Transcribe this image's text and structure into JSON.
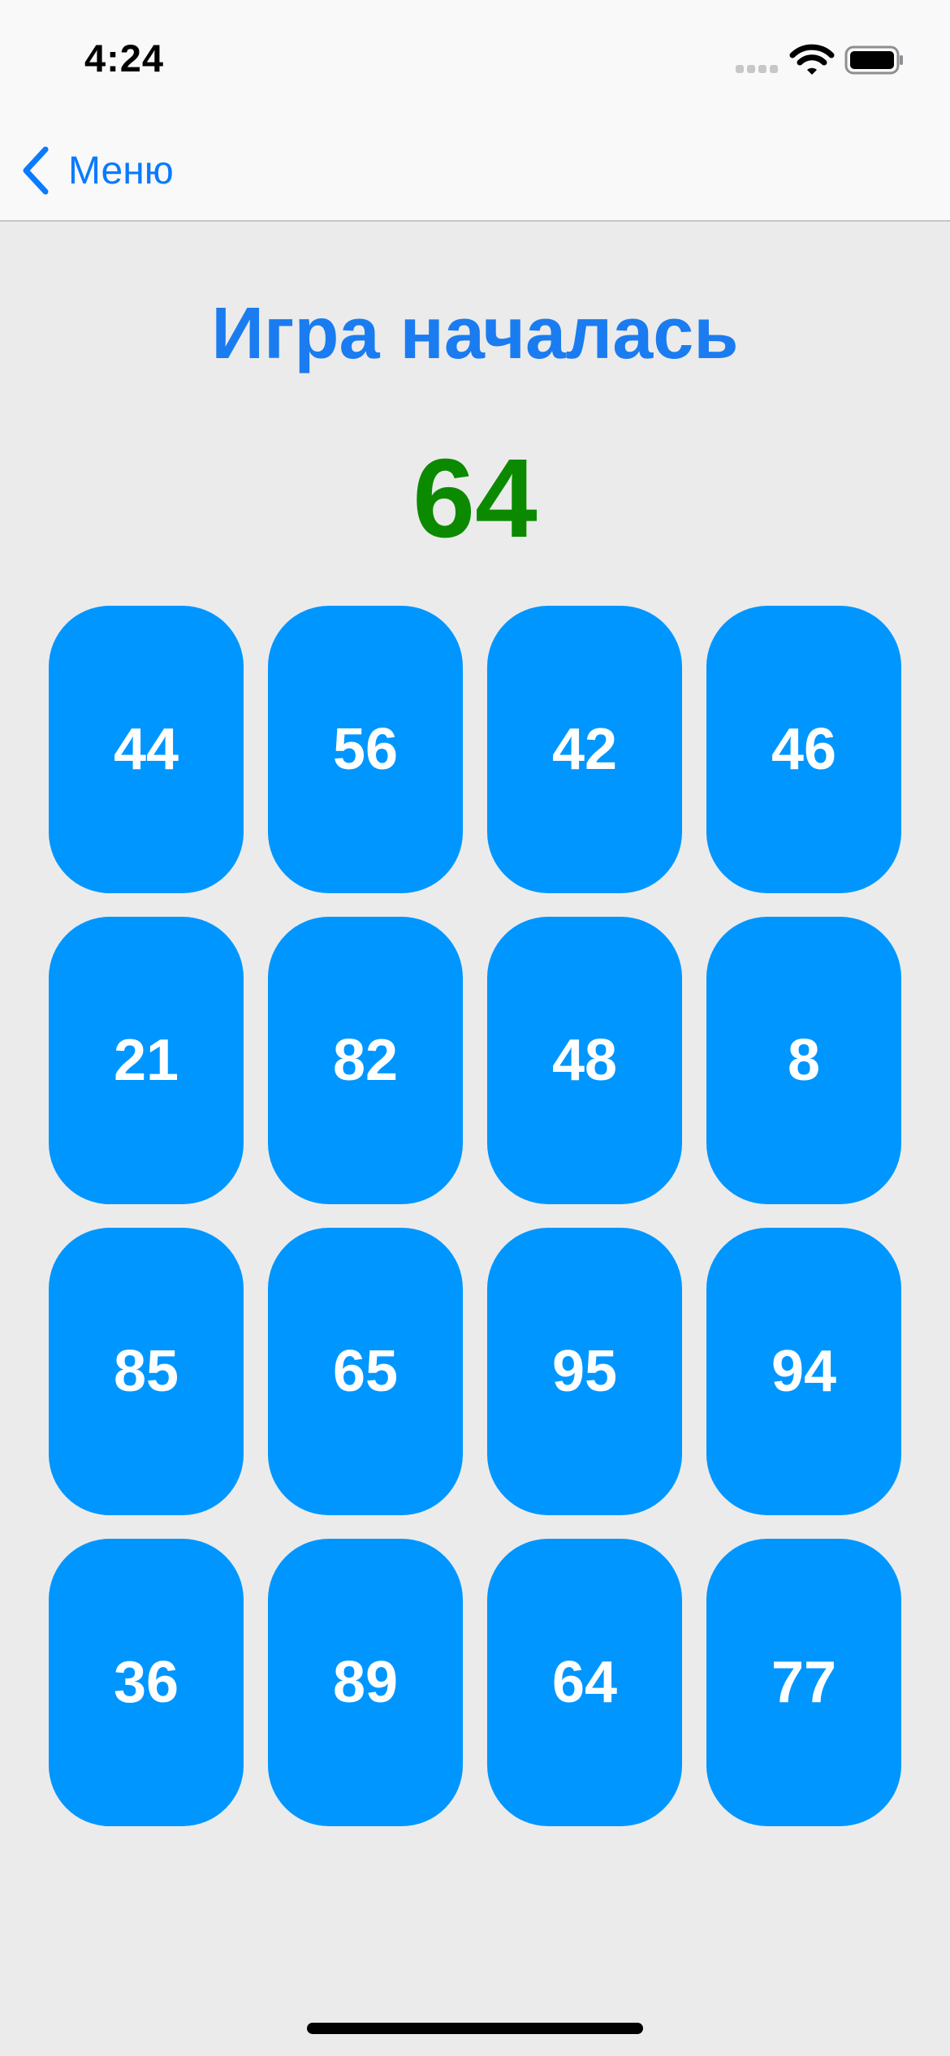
{
  "status_bar": {
    "time": "4:24"
  },
  "nav": {
    "back_label": "Меню"
  },
  "game": {
    "title": "Игра началась",
    "target": "64",
    "cards": [
      "44",
      "56",
      "42",
      "46",
      "21",
      "82",
      "48",
      "8",
      "85",
      "65",
      "95",
      "94",
      "36",
      "89",
      "64",
      "77"
    ]
  },
  "colors": {
    "background": "#ebebeb",
    "nav_background": "#f9f9f9",
    "accent_blue": "#0a7aff",
    "title_blue": "#1a7cf0",
    "target_green": "#0b8a00",
    "card_blue": "#0096ff",
    "card_text": "#ffffff"
  },
  "icons": {
    "back": "chevron-left-icon",
    "signal": "cellular-signal-icon",
    "wifi": "wifi-icon",
    "battery": "battery-icon"
  }
}
